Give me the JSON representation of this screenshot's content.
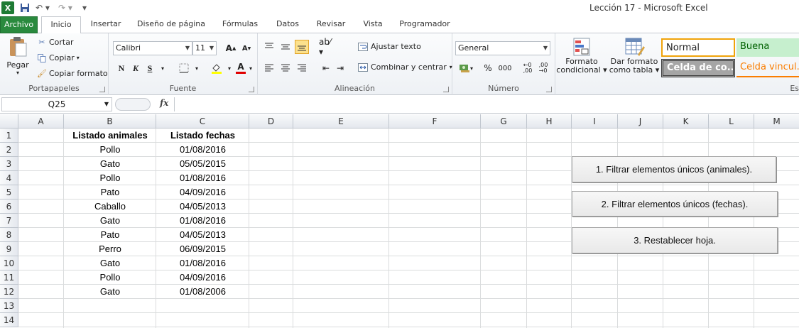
{
  "window": {
    "title": "Lección 17 -  Microsoft Excel"
  },
  "tabs": [
    "Archivo",
    "Inicio",
    "Insertar",
    "Diseño de página",
    "Fórmulas",
    "Datos",
    "Revisar",
    "Vista",
    "Programador"
  ],
  "ribbon": {
    "clipboard": {
      "paste": "Pegar",
      "cut": "Cortar",
      "copy": "Copiar",
      "format_painter": "Copiar formato",
      "label": "Portapapeles"
    },
    "font": {
      "name": "Calibri",
      "size": "11",
      "bold": "N",
      "italic": "K",
      "underline": "S",
      "label": "Fuente"
    },
    "alignment": {
      "wrap": "Ajustar texto",
      "merge": "Combinar y centrar",
      "label": "Alineación"
    },
    "number": {
      "format": "General",
      "percent": "%",
      "thousands": "000",
      "label": "Número"
    },
    "styles": {
      "conditional_1": "Formato",
      "conditional_2": "condicional",
      "as_table_1": "Dar formato",
      "as_table_2": "como tabla",
      "normal": "Normal",
      "good": "Buena",
      "check_cell": "Celda de co...",
      "linked_cell": "Celda vincul...",
      "label": "Es"
    }
  },
  "formula_bar": {
    "name_box": "Q25",
    "fx": "fx",
    "value": ""
  },
  "sheet": {
    "columns": [
      "A",
      "B",
      "C",
      "D",
      "E",
      "F",
      "G",
      "H",
      "I",
      "J",
      "K",
      "L",
      "M"
    ],
    "rows": [
      "1",
      "2",
      "3",
      "4",
      "5",
      "6",
      "7",
      "8",
      "9",
      "10",
      "11",
      "12",
      "13",
      "14"
    ],
    "header_b": "Listado animales",
    "header_c": "Listado fechas",
    "data": [
      {
        "animal": "Pollo",
        "fecha": "01/08/2016"
      },
      {
        "animal": "Gato",
        "fecha": "05/05/2015"
      },
      {
        "animal": "Pollo",
        "fecha": "01/08/2016"
      },
      {
        "animal": "Pato",
        "fecha": "04/09/2016"
      },
      {
        "animal": "Caballo",
        "fecha": "04/05/2013"
      },
      {
        "animal": "Gato",
        "fecha": "01/08/2016"
      },
      {
        "animal": "Pato",
        "fecha": "04/05/2013"
      },
      {
        "animal": "Perro",
        "fecha": "06/09/2015"
      },
      {
        "animal": "Gato",
        "fecha": "01/08/2016"
      },
      {
        "animal": "Pollo",
        "fecha": "04/09/2016"
      },
      {
        "animal": "Gato",
        "fecha": "01/08/2006"
      }
    ]
  },
  "buttons": [
    "1. Filtrar elementos únicos (animales).",
    "2. Filtrar elementos únicos (fechas).",
    "3. Restablecer hoja."
  ],
  "colors": {
    "file_tab": "#2a8a3e",
    "good_fill": "#c6efce",
    "good_text": "#006100",
    "linked_text": "#fa7d00",
    "check_fill": "#a5a5a5",
    "normal_border": "#f0a30a"
  }
}
